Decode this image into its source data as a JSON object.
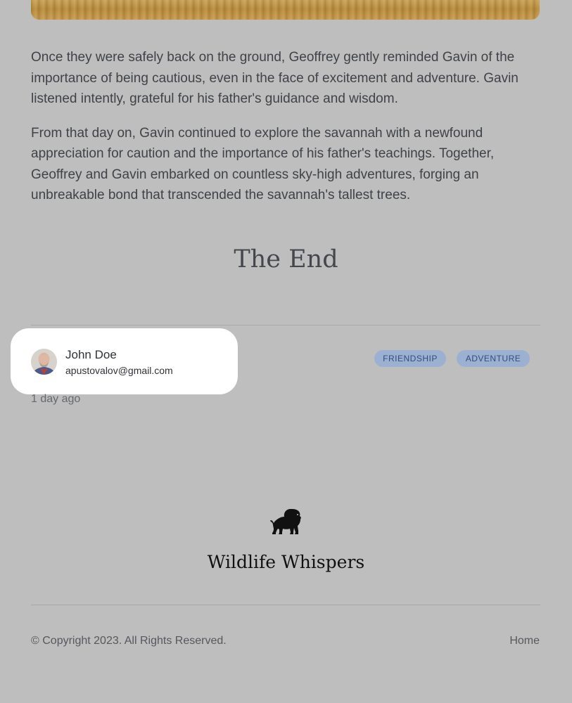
{
  "story": {
    "paragraphs": [
      "Once they were safely back on the ground, Geoffrey gently reminded Gavin of the importance of being cautious, even in the face of excitement and adventure. Gavin listened intently, grateful for his father's guidance and wisdom.",
      "From that day on, Gavin continued to explore the savannah with a newfound appreciation for caution and the importance of his father's teachings. Together, Geoffrey and Gavin embarked on countless sky-high adventures, forging an unbreakable bond that transcended the savannah's tallest trees."
    ],
    "ending": "The End"
  },
  "author": {
    "name": "John Doe",
    "email": "apustovalov@gmail.com",
    "posted": "1 day ago"
  },
  "tags": [
    "FRIENDSHIP",
    "ADVENTURE"
  ],
  "footer": {
    "brand_name": "Wildlife Whispers",
    "logo_icon": "lion-icon",
    "copyright": "© Copyright 2023. All Rights Reserved.",
    "home_label": "Home"
  },
  "colors": {
    "background": "#bebebe",
    "tag_background": "#9cb1d2",
    "tag_text": "#334c7a",
    "card_background": "#ffffff"
  }
}
